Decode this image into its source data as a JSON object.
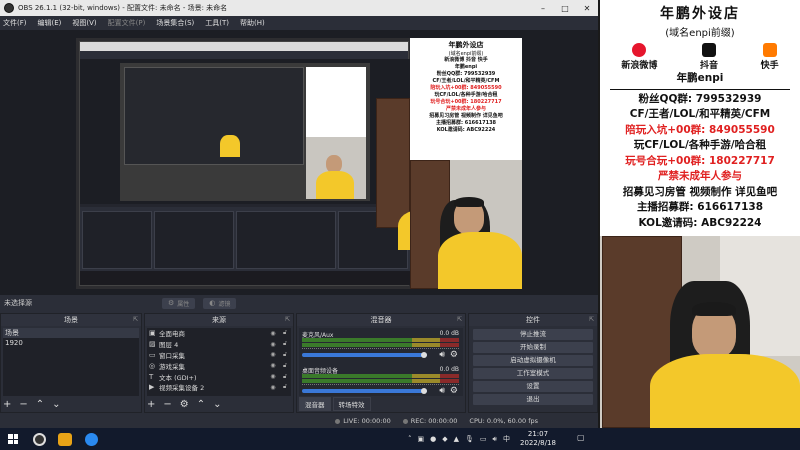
{
  "window": {
    "title": "OBS 26.1.1 (32-bit, windows) - 配置文件: 未命名 - 场景: 未命名",
    "menu": [
      "文件(F)",
      "编辑(E)",
      "视图(V)",
      "配置文件(P)",
      "场景集合(S)",
      "工具(T)",
      "帮助(H)"
    ]
  },
  "context_bar": {
    "no_source": "未选择源",
    "properties": "属性",
    "filters": "滤镜"
  },
  "scenes": {
    "header": "场景",
    "items": [
      "场景",
      "1920"
    ]
  },
  "sources": {
    "header": "来源",
    "items": [
      {
        "icon": "display-capture",
        "name": "全面电商"
      },
      {
        "icon": "image",
        "name": "图层 4"
      },
      {
        "icon": "window-capture",
        "name": "窗口采集"
      },
      {
        "icon": "game-capture",
        "name": "游戏采集"
      },
      {
        "icon": "text",
        "name": "文本 (GDI+)"
      },
      {
        "icon": "video-capture",
        "name": "视频采集设备 2"
      }
    ]
  },
  "mixer": {
    "header": "混音器",
    "tracks": [
      {
        "name": "麦克风/Aux",
        "db": "0.0 dB"
      },
      {
        "name": "桌面音频设备",
        "db": "0.0 dB"
      }
    ],
    "tab_mixer": "混音器",
    "tab_transitions": "转场特效"
  },
  "controls": {
    "header": "控件",
    "buttons": [
      "停止推流",
      "开始录制",
      "启动虚拟摄像机",
      "工作室模式",
      "设置",
      "退出"
    ]
  },
  "status": {
    "live": "LIVE: 00:00:00",
    "rec": "REC: 00:00:00",
    "cpu": "CPU: 0.0%, 60.00 fps"
  },
  "taskbar": {
    "time": "21:07",
    "date": "2022/8/18",
    "ime": "中"
  },
  "overlay": {
    "title": "年鹏外设店",
    "subtitle": "(域名enpi前缀)",
    "social_weibo": "新浪微博",
    "social_douyin": "抖音",
    "social_kuaishou": "快手",
    "handle": "年鹏enpi",
    "fans_qq": "粉丝QQ群: 799532939",
    "games": "CF/王者/LOL/和平精英/CFM",
    "partner": "陪玩入坑+00群: 849055590",
    "games2": "玩CF/LOL/各种手游/哈合租",
    "join": "玩号合玩+00群: 180227717",
    "warning": "严禁未成年人参与",
    "recruit": "招募见习房管 视频制作 详见鱼吧",
    "host": "主播招募群: 616617138",
    "kol": "KOL邀请码: ABC92224"
  },
  "mini_overlay": {
    "title": "年鹏外设店",
    "subtitle": "(域名enpi前缀)",
    "rows": [
      "新浪微博  抖音  快手",
      "年鹏enpi",
      "粉丝QQ群: 799532939",
      "CF/王者/LOL/和平精英/CFM",
      "陪玩入坑+00群: 849055590",
      "玩CF/LOL/各种手游/哈合租",
      "玩号合玩+00群: 180227717",
      "严禁未成年人参与",
      "招募见习房管 视频制作 详见鱼吧",
      "主播招募群: 616617138",
      "KOL邀请码: ABC92224"
    ]
  },
  "colors": {
    "obs_bg": "#2b2e38",
    "accent_red": "#e02020",
    "shirt_yellow": "#f3c82a",
    "taskbar": "#121a2c"
  }
}
